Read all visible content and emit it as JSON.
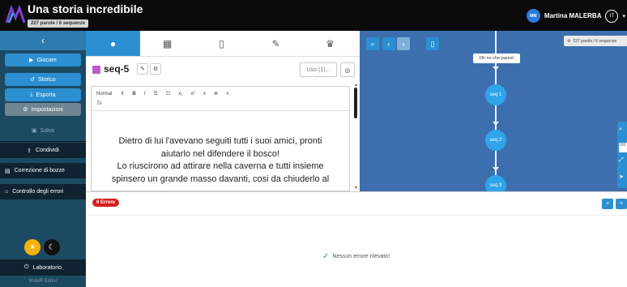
{
  "header": {
    "title": "Una storia incredibile",
    "stats": "227 parole / 6 sequenze",
    "user_initials": "MM",
    "user_name": "Martina MALERBA",
    "lang": "IT",
    "caret": "▾"
  },
  "sidebar": {
    "back": "‹",
    "play": "Giocare",
    "history": "Storico",
    "export": "Esporta",
    "settings": "Impostazioni",
    "save": "Salva",
    "share": "Condividi",
    "proofread": "Correzione di bozze",
    "error_check": "Controllo degli errori",
    "lab": "Laboratorio",
    "footer": "MobiR Editor"
  },
  "editor": {
    "seq_name": "seq-5",
    "use_select": "Uso (1)...",
    "toolbar_format": "Normal",
    "toolbar_bold": "B",
    "toolbar_italic": "I",
    "toolbar_clear": "Tx",
    "text_lines": [
      "Dietro di lui l'avevano seguiti tutti i suoi amici, pronti",
      "aiutarlo nel difendere il bosco!",
      "Lo riuscirono ad attirare nella caverna e tutti insieme",
      "spinsero  un grande masso davanti, cosi da chiuderlo al"
    ]
  },
  "graph": {
    "stats": "227 parole / 6 sequenze",
    "tooltip": "Oh no che paura!",
    "nodes": [
      "seq 1",
      "seq 2",
      "seq 3"
    ],
    "side_field": "100"
  },
  "bottom": {
    "errors_badge": "0 Errore",
    "ok_message": "Nessun errore rilevato!"
  },
  "colors": {
    "accent": "#2c8fd1",
    "sidebar": "#1d4a63",
    "graph_bg": "#3d6fae",
    "error": "#d81f1f",
    "seq_color": "#c05ccc"
  }
}
